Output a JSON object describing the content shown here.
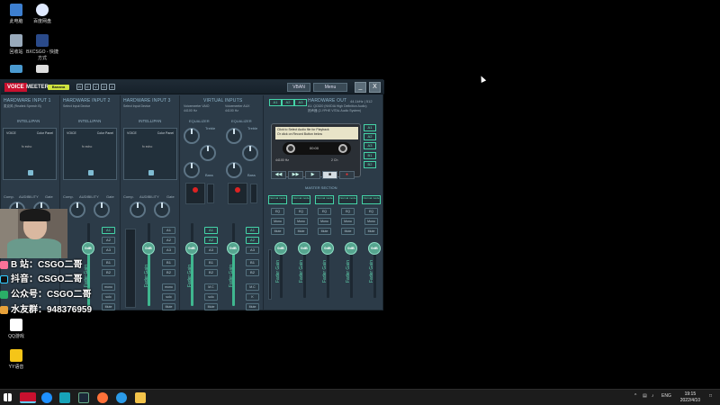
{
  "desktop": {
    "icons": [
      {
        "label": "此电脑",
        "color": "#3d7fd0"
      },
      {
        "label": "百度网盘",
        "color": "#e8f0ff"
      },
      {
        "label": "回收站",
        "color": "#9ab"
      },
      {
        "label": "BXCSGO - 快捷方式",
        "color": "#2a4a8a"
      },
      {
        "label": "",
        "color": "#4a9ad0"
      },
      {
        "label": "",
        "color": "#eee"
      },
      {
        "label": "QQ游戏",
        "color": "#fff"
      },
      {
        "label": "YY语音",
        "color": "#f5c518"
      }
    ]
  },
  "voicemeeter": {
    "logo_voice": "VOICE",
    "logo_meeter": "MEETER",
    "logo_banana": "Banana",
    "vban_label": "VBAN",
    "menu_label": "Menu",
    "minimize": "_",
    "close": "X",
    "strips": [
      {
        "title": "HARDWARE INPUT 1",
        "sub": "麦克风 (Realtek Speech B)",
        "intelli": "INTELLIPAN"
      },
      {
        "title": "HARDWARE INPUT 2",
        "sub": "Select Input Device",
        "intelli": "INTELLIPAN"
      },
      {
        "title": "HARDWARE INPUT 3",
        "sub": "Select Input Device",
        "intelli": "INTELLIPAN"
      }
    ],
    "virtual_inputs_title": "VIRTUAL INPUTS",
    "virtual_inputs": [
      {
        "name": "Voicemeeter VAIO",
        "sub": "44100 Hz"
      },
      {
        "name": "Voicemeeter AUX",
        "sub": "44100 Hz"
      }
    ],
    "equalizer_label": "EQUALIZER",
    "voice_label": "VOICE",
    "color_panel": "Color Panel",
    "fx_echo": "fx echo",
    "brightness": "brightness",
    "lo": "Lo",
    "hi": "Hi",
    "comp_label": "Comp.",
    "audibility_label": "AUDIBILITY",
    "gate_label": "Gate",
    "treble_label": "Treble",
    "bass_label": "Bass",
    "fader_gain_label": "Fader Gain",
    "fader_db": "0dB",
    "bus_labels": [
      "A1",
      "A2",
      "A3",
      "B1",
      "B2"
    ],
    "mono_label": "mono",
    "solo_label": "solo",
    "mute_label": "Mute",
    "mc_label": "M.C",
    "k_label": "K",
    "hw_out": {
      "title": "HARDWARE OUT",
      "rate": "44.1kHz | 512",
      "device1": "A1: QC620 (NVIDIA High Definition Audio)",
      "device2": "扬声器 (2-YPHE VITAL Audio System)",
      "buses": [
        "A1",
        "A2",
        "A3"
      ]
    },
    "tape": {
      "message1": "Click to Select Audio file for Playback",
      "message2": "Or click on Record Button below",
      "time": "00:00",
      "freq": "44100 Hz",
      "ch": "2 Ch",
      "out_buses": [
        "A1",
        "A2",
        "A3",
        "B1",
        "B2"
      ]
    },
    "master_section_label": "MASTER SECTION",
    "master_cols": [
      {
        "mode": "Normal mode",
        "eq": "EQ",
        "mono": "Mono",
        "mute": "Mute",
        "label": "A1"
      },
      {
        "mode": "Normal mode",
        "eq": "EQ",
        "mono": "Mono",
        "mute": "Mute",
        "label": "A2"
      },
      {
        "mode": "Normal mode",
        "eq": "EQ",
        "mono": "Mono",
        "mute": "Mute",
        "label": "A3"
      },
      {
        "mode": "Normal mode",
        "eq": "EQ",
        "mono": "Mono",
        "mute": "Mute",
        "label": "B1"
      },
      {
        "mode": "Normal mode",
        "eq": "EQ",
        "mono": "Mono",
        "mute": "Mute",
        "label": "B2"
      }
    ]
  },
  "overlay": {
    "lines": [
      {
        "text": "B 站：CSGO二哥",
        "color": "#fb7299"
      },
      {
        "text": "抖音：CSGO二哥",
        "color": "#111"
      },
      {
        "text": "公众号：CSGO二哥",
        "color": "#2aae67"
      },
      {
        "text": "水友群：948376959",
        "color": "#e8a23a"
      }
    ]
  },
  "taskbar": {
    "lang": "ENG",
    "time": "19:15",
    "date": "2022/4/10"
  }
}
